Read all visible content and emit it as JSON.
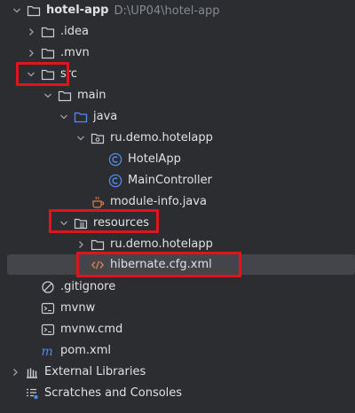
{
  "colors": {
    "background": "#2b2d30",
    "selected_row": "#43454a",
    "highlight": "#e0151b",
    "class_icon": "#548af7",
    "xml_icon": "#e0814d",
    "java_file_icon": "#e0814d"
  },
  "tree": {
    "root": {
      "label": "hotel-app",
      "path": "D:\\UP04\\hotel-app",
      "icon": "folder-icon"
    },
    "idea": {
      "label": ".idea",
      "icon": "folder-icon"
    },
    "mvn": {
      "label": ".mvn",
      "icon": "folder-icon"
    },
    "src": {
      "label": "src",
      "icon": "folder-icon"
    },
    "main": {
      "label": "main",
      "icon": "folder-icon"
    },
    "java": {
      "label": "java",
      "icon": "source-folder-icon"
    },
    "pkg_java": {
      "label": "ru.demo.hotelapp",
      "icon": "package-icon"
    },
    "hotelapp": {
      "label": "HotelApp",
      "icon": "class-icon"
    },
    "maincontroller": {
      "label": "MainController",
      "icon": "class-icon"
    },
    "moduleinfo": {
      "label": "module-info.java",
      "icon": "java-module-icon"
    },
    "resources": {
      "label": "resources",
      "icon": "resources-folder-icon"
    },
    "pkg_res": {
      "label": "ru.demo.hotelapp",
      "icon": "folder-icon"
    },
    "hibernate": {
      "label": "hibernate.cfg.xml",
      "icon": "xml-file-icon"
    },
    "gitignore": {
      "label": ".gitignore",
      "icon": "gitignore-icon"
    },
    "mvnw": {
      "label": "mvnw",
      "icon": "terminal-file-icon"
    },
    "mvnwcmd": {
      "label": "mvnw.cmd",
      "icon": "terminal-file-icon"
    },
    "pom": {
      "label": "pom.xml",
      "icon": "maven-icon"
    },
    "extlibs": {
      "label": "External Libraries",
      "icon": "libraries-icon"
    },
    "scratches": {
      "label": "Scratches and Consoles",
      "icon": "scratches-icon"
    }
  }
}
